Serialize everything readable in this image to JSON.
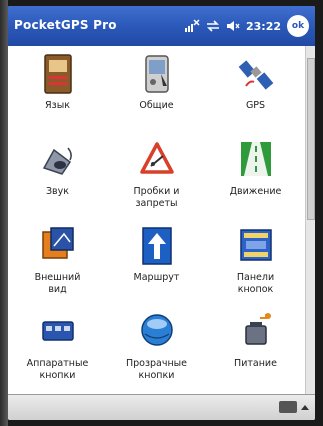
{
  "window": {
    "title": "PocketGPS Pro",
    "clock": "23:22",
    "ok_label": "ok"
  },
  "colors": {
    "titlebar": "#2a57b8",
    "screen_bg": "#ffffff"
  },
  "menu": {
    "items": [
      {
        "label": "Язык",
        "icon": "language-book-icon"
      },
      {
        "label": "Общие",
        "icon": "general-settings-icon"
      },
      {
        "label": "GPS",
        "icon": "satellite-icon"
      },
      {
        "label": "Звук",
        "icon": "speaker-sound-icon"
      },
      {
        "label": "Пробки и\nзапреты",
        "icon": "traffic-warning-icon"
      },
      {
        "label": "Движение",
        "icon": "road-movement-icon"
      },
      {
        "label": "Внешний\nвид",
        "icon": "appearance-icon"
      },
      {
        "label": "Маршрут",
        "icon": "route-arrow-icon"
      },
      {
        "label": "Панели\nкнопок",
        "icon": "button-panels-icon"
      },
      {
        "label": "Аппаратные\nкнопки",
        "icon": "hardware-buttons-icon"
      },
      {
        "label": "Прозрачные\nкнопки",
        "icon": "transparent-buttons-icon"
      },
      {
        "label": "Питание",
        "icon": "power-icon"
      }
    ]
  }
}
